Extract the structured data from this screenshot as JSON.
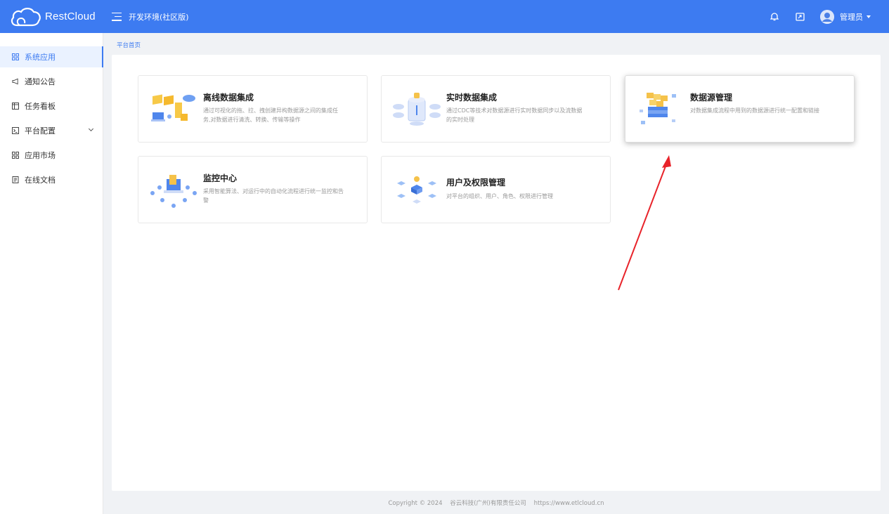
{
  "header": {
    "logo_text": "RestCloud",
    "env_title": "开发环境(社区版)",
    "user_name": "管理员",
    "icons": [
      "bell-icon",
      "screen-share-icon",
      "avatar-icon"
    ],
    "bg_color": "#3d7bf1"
  },
  "sidebar": {
    "items": [
      {
        "label": "系统应用",
        "icon": "grid-icon",
        "active": true
      },
      {
        "label": "通知公告",
        "icon": "megaphone-icon",
        "active": false
      },
      {
        "label": "任务看板",
        "icon": "board-icon",
        "active": false
      },
      {
        "label": "平台配置",
        "icon": "terminal-icon",
        "active": false,
        "expandable": true
      },
      {
        "label": "应用市场",
        "icon": "grid-icon",
        "active": false
      },
      {
        "label": "在线文档",
        "icon": "document-icon",
        "active": false
      }
    ]
  },
  "breadcrumb": "平台首页",
  "cards": [
    {
      "title": "离线数据集成",
      "desc": "通过可视化的拖、拉、拽创建异构数据源之间的集成任务,对数据进行清洗、转换、传输等操作",
      "icon": "etl-illustration"
    },
    {
      "title": "实时数据集成",
      "desc": "通过CDC等技术对数据源进行实时数据同步以及流数据的实时处理",
      "icon": "cdc-illustration"
    },
    {
      "title": "数据源管理",
      "desc": "对数据集成流程中用到的数据源进行统一配置和链接",
      "icon": "datasource-illustration",
      "hover": true
    },
    {
      "title": "监控中心",
      "desc": "采用智能算法、对运行中的自动化流程进行统一监控和告警",
      "icon": "monitor-illustration"
    },
    {
      "title": "用户及权限管理",
      "desc": "对平台的组织、用户、角色、权限进行管理",
      "icon": "permission-illustration"
    }
  ],
  "footer": {
    "copyright": "Copyright © 2024",
    "company": "谷云科技(广州)有限责任公司",
    "url": "https://www.etlcloud.cn"
  },
  "annotation": {
    "color": "#e8232a"
  }
}
